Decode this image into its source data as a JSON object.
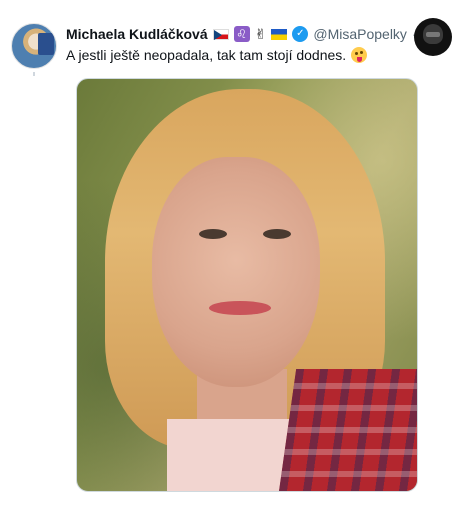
{
  "tweet": {
    "author_name": "Michaela Kudláčková",
    "handle": "@MisaPopelky",
    "separator": "·",
    "text": "A jestli ještě neopadala, tak tam stojí dodnes.",
    "name_icons": [
      "czech-flag-icon",
      "leo-zodiac-icon",
      "victory-hand-icon",
      "ukraine-flag-icon",
      "verified-badge-icon"
    ],
    "text_emoji": "winking-face-with-tongue-icon"
  },
  "colors": {
    "verified": "#1d9bf0",
    "text_primary": "#0f1419",
    "text_secondary": "#536471"
  }
}
